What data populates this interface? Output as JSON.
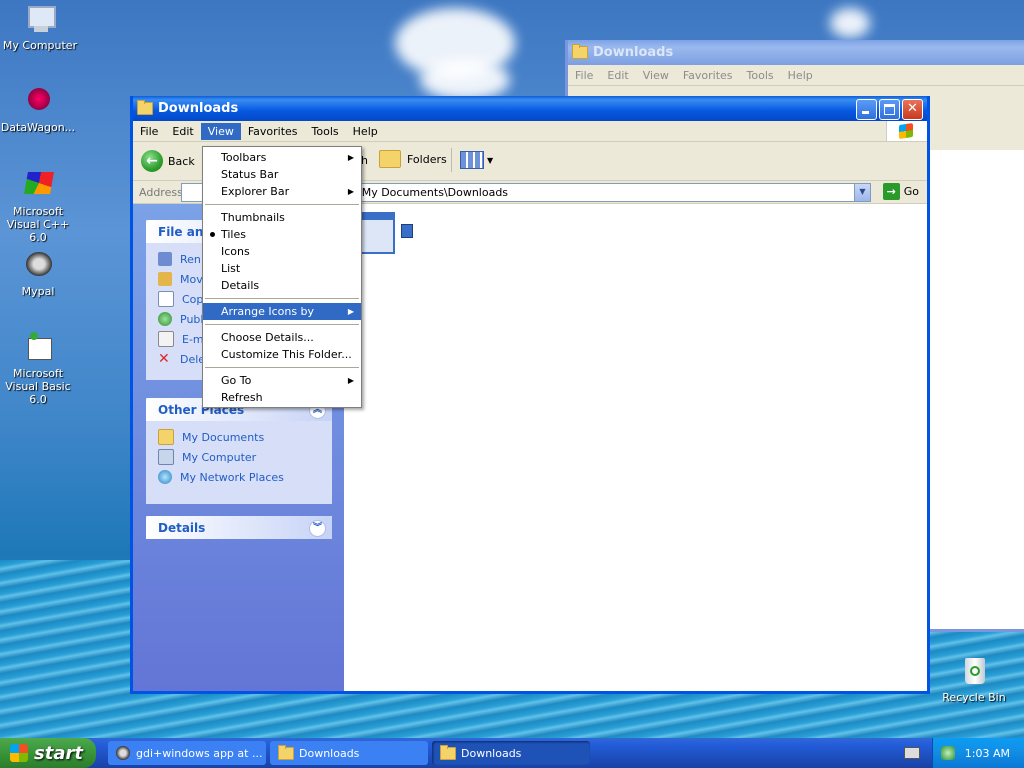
{
  "desktop": {
    "icons": [
      {
        "label": "My Computer",
        "icon": "computer-icon"
      },
      {
        "label": "DataWagon...",
        "icon": "datawagon-icon"
      },
      {
        "label": "Microsoft Visual C++ 6.0",
        "icon": "visual-cpp-icon"
      },
      {
        "label": "Mypal",
        "icon": "mypal-icon"
      },
      {
        "label": "Microsoft Visual Basic 6.0",
        "icon": "visual-basic-icon"
      },
      {
        "label": "Recycle Bin",
        "icon": "recycle-bin-icon"
      }
    ]
  },
  "back_window": {
    "title": "Downloads",
    "menu": [
      "File",
      "Edit",
      "View",
      "Favorites",
      "Tools",
      "Help"
    ]
  },
  "front_window": {
    "title": "Downloads",
    "menu": [
      "File",
      "Edit",
      "View",
      "Favorites",
      "Tools",
      "Help"
    ],
    "active_menu_index": 2,
    "toolbar": {
      "back_label": "Back",
      "folders_label": "Folders",
      "search_fragment": "h"
    },
    "address": {
      "label": "Address",
      "value": "\\My Documents\\Downloads",
      "go_label": "Go"
    },
    "tasks_panel": {
      "file_tasks": {
        "title": "File and",
        "items": [
          "Ren",
          "Mov",
          "Cop",
          "Publ",
          "E-m",
          "Dele"
        ]
      },
      "other_places": {
        "title": "Other Places",
        "items": [
          "My Documents",
          "My Computer",
          "My Network Places"
        ]
      },
      "details": {
        "title": "Details"
      }
    }
  },
  "view_menu": {
    "groups": [
      [
        {
          "label": "Toolbars",
          "submenu": true
        },
        {
          "label": "Status Bar",
          "submenu": false
        },
        {
          "label": "Explorer Bar",
          "submenu": true
        }
      ],
      [
        {
          "label": "Thumbnails",
          "submenu": false
        },
        {
          "label": "Tiles",
          "submenu": false,
          "checked": true
        },
        {
          "label": "Icons",
          "submenu": false
        },
        {
          "label": "List",
          "submenu": false
        },
        {
          "label": "Details",
          "submenu": false
        }
      ],
      [
        {
          "label": "Arrange Icons by",
          "submenu": true,
          "highlighted": true
        }
      ],
      [
        {
          "label": "Choose Details...",
          "submenu": false
        },
        {
          "label": "Customize This Folder...",
          "submenu": false
        }
      ],
      [
        {
          "label": "Go To",
          "submenu": true
        },
        {
          "label": "Refresh",
          "submenu": false
        }
      ]
    ]
  },
  "taskbar": {
    "start_label": "start",
    "buttons": [
      {
        "label": "gdi+windows app at ...",
        "active": false
      },
      {
        "label": "Downloads",
        "active": false
      },
      {
        "label": "Downloads",
        "active": true
      }
    ],
    "clock": "1:03 AM"
  }
}
